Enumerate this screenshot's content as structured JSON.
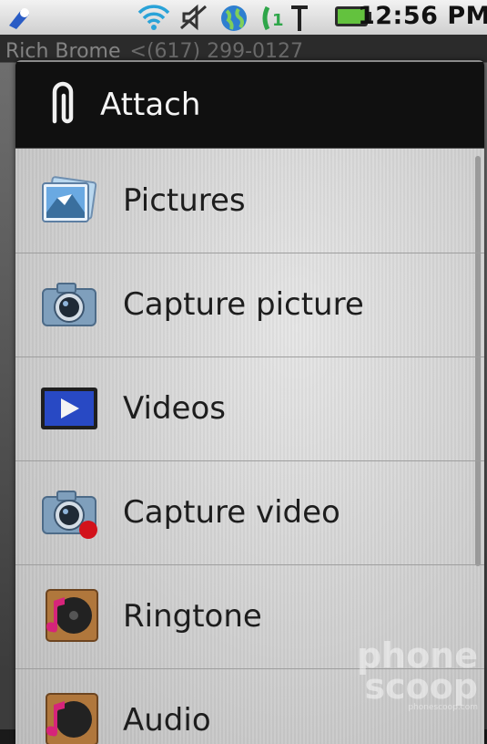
{
  "status_bar": {
    "time": "12:56 PM",
    "icons": [
      "app-notification-icon",
      "wifi-icon",
      "mute-icon",
      "globe-icon",
      "call-forward-icon",
      "signal-icon",
      "battery-icon"
    ]
  },
  "background_app": {
    "header_name": "Rich Brome",
    "header_number": "<(617) 299-0127"
  },
  "dialog": {
    "title": "Attach",
    "title_icon": "paperclip-icon",
    "items": [
      {
        "label": "Pictures",
        "icon": "pictures-icon"
      },
      {
        "label": "Capture picture",
        "icon": "camera-icon"
      },
      {
        "label": "Videos",
        "icon": "videos-icon"
      },
      {
        "label": "Capture video",
        "icon": "video-camera-icon"
      },
      {
        "label": "Ringtone",
        "icon": "ringtone-icon"
      },
      {
        "label": "Audio",
        "icon": "audio-icon"
      }
    ]
  },
  "watermark": {
    "line1": "phone",
    "line2": "scoop",
    "small": "phonescoop.com"
  }
}
